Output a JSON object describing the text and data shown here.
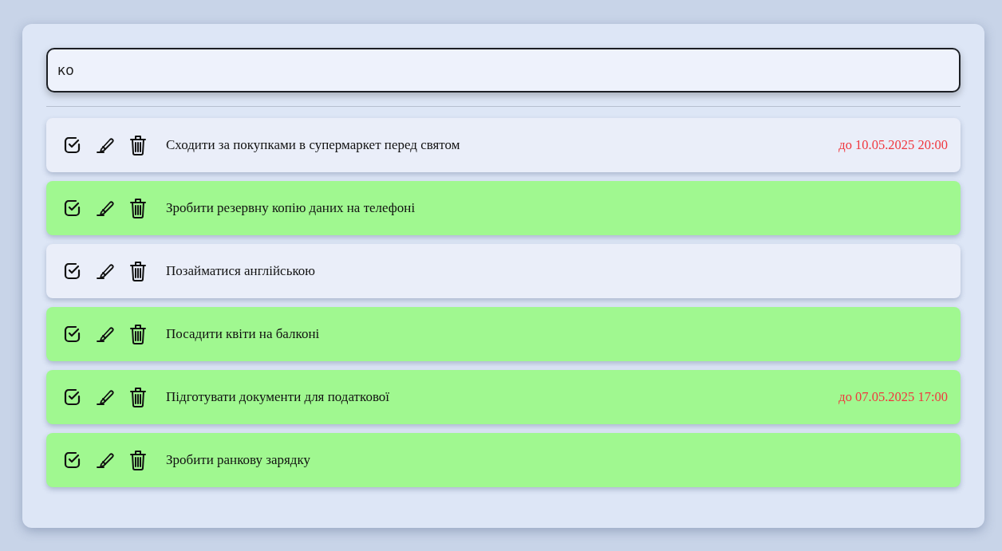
{
  "search": {
    "value": "ко"
  },
  "tasks": [
    {
      "title": "Сходити за покупками в супермаркет перед святом",
      "deadline": "до 10.05.2025 20:00",
      "completed": false
    },
    {
      "title": "Зробити резервну копію даних на телефоні",
      "completed": true
    },
    {
      "title": "Позайматися англійською",
      "completed": false
    },
    {
      "title": "Посадити квіти на балконі",
      "completed": true
    },
    {
      "title": "Підготувати документи для податкової",
      "deadline": "до 07.05.2025 17:00",
      "completed": true
    },
    {
      "title": "Зробити ранкову зарядку",
      "completed": true
    }
  ]
}
